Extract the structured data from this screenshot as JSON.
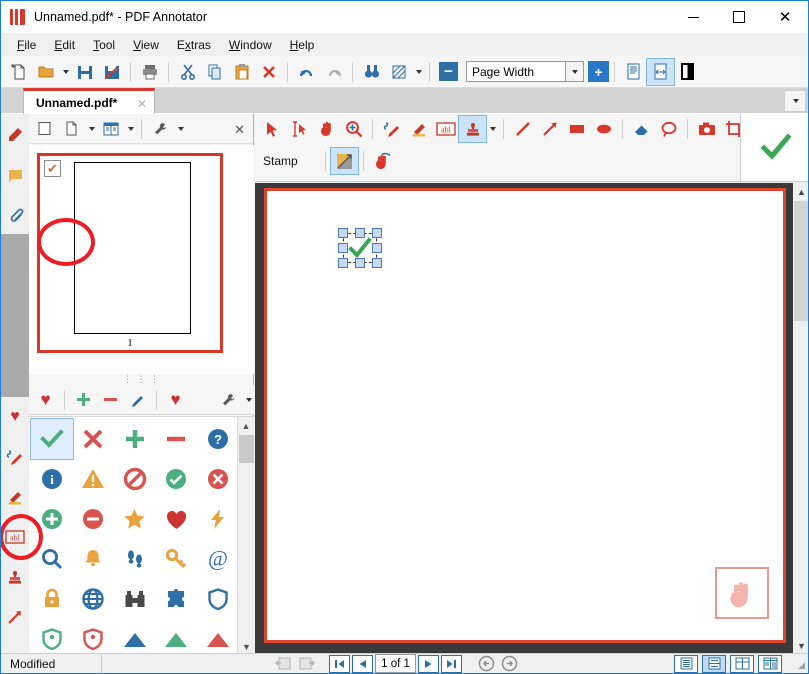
{
  "window": {
    "title": "Unnamed.pdf* - PDF Annotator",
    "app_icon": "pdf-annotator-logo-icon",
    "controls": {
      "minimize": "—",
      "maximize": "□",
      "close": "✕"
    }
  },
  "menu": {
    "items": [
      {
        "label": "File",
        "accel": "F"
      },
      {
        "label": "Edit",
        "accel": "E"
      },
      {
        "label": "Tool",
        "accel": "T"
      },
      {
        "label": "View",
        "accel": "V"
      },
      {
        "label": "Extras",
        "accel": "x"
      },
      {
        "label": "Window",
        "accel": "W"
      },
      {
        "label": "Help",
        "accel": "H"
      }
    ]
  },
  "main_toolbar": {
    "buttons": [
      {
        "name": "new-document-button",
        "tip": "New"
      },
      {
        "name": "open-document-button",
        "tip": "Open"
      },
      {
        "name": "save-button",
        "tip": "Save"
      },
      {
        "name": "save-as-button",
        "tip": "Save As"
      },
      {
        "name": "print-button",
        "tip": "Print"
      },
      {
        "name": "cut-button",
        "tip": "Cut"
      },
      {
        "name": "copy-button",
        "tip": "Copy"
      },
      {
        "name": "paste-button",
        "tip": "Paste"
      },
      {
        "name": "delete-button",
        "tip": "Delete"
      },
      {
        "name": "undo-button",
        "tip": "Undo"
      },
      {
        "name": "redo-button",
        "tip": "Redo"
      },
      {
        "name": "find-button",
        "tip": "Find"
      },
      {
        "name": "sharpen-button",
        "tip": "Enhance"
      }
    ],
    "zoom": {
      "out_label": "−",
      "value": "Page Width",
      "in_label": "+"
    },
    "page_modes": [
      {
        "name": "single-page-view-button"
      },
      {
        "name": "fit-width-view-button",
        "selected": true
      },
      {
        "name": "full-screen-view-button"
      }
    ]
  },
  "tabs": {
    "documents": [
      {
        "label": "Unnamed.pdf*",
        "close": "✕",
        "active": true
      }
    ],
    "overflow_icon": "chevron-down-icon"
  },
  "left_vertical_tabs": {
    "top_group": [
      {
        "name": "bookmarks-tab",
        "icon": "bookmark-icon",
        "color": "#c0392b"
      },
      {
        "name": "notes-tab",
        "icon": "note-icon",
        "color": "#e9b44c"
      },
      {
        "name": "attachments-tab",
        "icon": "paperclip-icon",
        "color": "#2e6fa8"
      }
    ],
    "bottom_group": [
      {
        "name": "favorites-tab",
        "icon": "heart-icon",
        "color": "#cc3333"
      },
      {
        "name": "pen-tab",
        "icon": "pen-icon",
        "color": "#2e6fa8"
      },
      {
        "name": "highlighter-tab",
        "icon": "highlighter-icon",
        "color": "#c0392b"
      },
      {
        "name": "text-tab",
        "icon": "abl-text-icon",
        "color": "#c0392b"
      },
      {
        "name": "stamps-tab",
        "icon": "stamp-icon",
        "color": "#c0392b",
        "selected": true
      },
      {
        "name": "arrow-tab",
        "icon": "arrow-icon",
        "color": "#d9372a"
      }
    ]
  },
  "left_panel": {
    "toolbar": [
      {
        "name": "thumbnail-toggle-button",
        "icon": "square-icon"
      },
      {
        "name": "page-layout-button",
        "icon": "page-icon"
      },
      {
        "name": "book-view-button",
        "icon": "book-icon"
      },
      {
        "name": "settings-button",
        "icon": "wrench-icon"
      }
    ],
    "close_label": "✕",
    "thumbnails": [
      {
        "page_number": "1",
        "checked": true,
        "selected": true
      }
    ]
  },
  "stamp_panel": {
    "toolbar": [
      {
        "name": "favorite-stamp-button",
        "icon": "heart-icon",
        "color": "#cc3333"
      },
      {
        "name": "add-stamp-button",
        "icon": "plus-icon",
        "color": "#4caf7d"
      },
      {
        "name": "remove-stamp-button",
        "icon": "minus-icon",
        "color": "#d9534f"
      },
      {
        "name": "edit-stamp-button",
        "icon": "pencil-icon",
        "color": "#2e6fa8"
      },
      {
        "name": "favorites-group-button",
        "icon": "heart-icon",
        "color": "#cc3333"
      },
      {
        "name": "stamp-settings-button",
        "icon": "wrench-icon",
        "color": "#555555"
      }
    ],
    "grid": [
      {
        "name": "stamp-check",
        "glyph": "✔",
        "color": "#4caf7d",
        "selected": true
      },
      {
        "name": "stamp-cross",
        "glyph": "✖",
        "color": "#d9534f"
      },
      {
        "name": "stamp-plus",
        "glyph": "✚",
        "color": "#4caf7d"
      },
      {
        "name": "stamp-minus",
        "glyph": "➖",
        "color": "#d9534f"
      },
      {
        "name": "stamp-question-circle",
        "glyph": "?",
        "color": "#2e6fa8"
      },
      {
        "name": "stamp-info-circle",
        "glyph": "i",
        "color": "#2e6fa8"
      },
      {
        "name": "stamp-warning-triangle",
        "glyph": "!",
        "color": "#e8a33d"
      },
      {
        "name": "stamp-no-entry",
        "glyph": "⃠",
        "color": "#d9534f"
      },
      {
        "name": "stamp-check-circle",
        "glyph": "✔",
        "color": "#4caf7d"
      },
      {
        "name": "stamp-cross-circle",
        "glyph": "✖",
        "color": "#d9534f"
      },
      {
        "name": "stamp-plus-circle",
        "glyph": "✚",
        "color": "#4caf7d"
      },
      {
        "name": "stamp-minus-circle",
        "glyph": "➖",
        "color": "#d9534f"
      },
      {
        "name": "stamp-star",
        "glyph": "★",
        "color": "#e8a33d"
      },
      {
        "name": "stamp-heart",
        "glyph": "♥",
        "color": "#cc3333"
      },
      {
        "name": "stamp-lightning",
        "glyph": "⚡",
        "color": "#e8a33d"
      },
      {
        "name": "stamp-magnifier",
        "glyph": "⚲",
        "color": "#2e6fa8"
      },
      {
        "name": "stamp-bell",
        "glyph": "ὑ4",
        "color": "#e8a33d"
      },
      {
        "name": "stamp-footprints",
        "glyph": "⁙",
        "color": "#2e6fa8"
      },
      {
        "name": "stamp-key",
        "glyph": "⚿",
        "color": "#e8a33d"
      },
      {
        "name": "stamp-at-sign",
        "glyph": "@",
        "color": "#2e6fa8"
      },
      {
        "name": "stamp-lock",
        "glyph": "ὑ2",
        "color": "#e8a33d"
      },
      {
        "name": "stamp-globe",
        "glyph": "ἱ0",
        "color": "#2e6fa8"
      },
      {
        "name": "stamp-binoculars",
        "glyph": "ὓD",
        "color": "#4a4a4a"
      },
      {
        "name": "stamp-puzzle",
        "glyph": "❖",
        "color": "#2e6fa8"
      },
      {
        "name": "stamp-shield",
        "glyph": "⛊",
        "color": "#2e6fa8"
      },
      {
        "name": "stamp-shield-green",
        "glyph": "⛊",
        "color": "#4caf7d"
      },
      {
        "name": "stamp-shield-red",
        "glyph": "⛊",
        "color": "#d9534f"
      },
      {
        "name": "stamp-flag-blue",
        "glyph": "◢",
        "color": "#2e6fa8"
      },
      {
        "name": "stamp-flag-green",
        "glyph": "◢",
        "color": "#4caf7d"
      },
      {
        "name": "stamp-flag-red",
        "glyph": "◢",
        "color": "#d9534f"
      }
    ]
  },
  "annotation_toolbar": {
    "row1": [
      {
        "name": "select-tool",
        "icon": "cursor-arrow-icon"
      },
      {
        "name": "text-select-tool",
        "icon": "text-cursor-icon"
      },
      {
        "name": "hand-tool",
        "icon": "hand-icon"
      },
      {
        "name": "zoom-tool",
        "icon": "magnifier-plus-icon"
      },
      {
        "name": "pen-tool",
        "icon": "pen-icon"
      },
      {
        "name": "highlighter-tool",
        "icon": "highlighter-icon"
      },
      {
        "name": "text-box-tool",
        "icon": "abl-text-icon"
      },
      {
        "name": "stamp-tool",
        "icon": "stamp-icon",
        "selected": true
      },
      {
        "name": "line-tool",
        "icon": "line-icon"
      },
      {
        "name": "arrow-tool",
        "icon": "arrow-icon"
      },
      {
        "name": "rectangle-tool",
        "icon": "rectangle-icon"
      },
      {
        "name": "ellipse-tool",
        "icon": "ellipse-icon"
      },
      {
        "name": "eraser-tool",
        "icon": "eraser-icon"
      },
      {
        "name": "lasso-tool",
        "icon": "lasso-icon"
      },
      {
        "name": "snapshot-tool",
        "icon": "camera-icon"
      },
      {
        "name": "crop-tool",
        "icon": "crop-icon"
      },
      {
        "name": "insert-image-tool",
        "icon": "image-add-icon"
      },
      {
        "name": "favorites-tool",
        "icon": "heart-icon"
      }
    ],
    "row2": {
      "label": "Stamp",
      "buttons": [
        {
          "name": "resize-stamp-button",
          "icon": "resize-diagonal-icon",
          "selected": true
        },
        {
          "name": "hand-stamp-button",
          "icon": "hand-stamp-icon"
        }
      ]
    },
    "preview": {
      "name": "stamp-preview",
      "icon": "green-check-icon",
      "color": "#3aa657"
    }
  },
  "document": {
    "placed_annotation": {
      "name": "placed-check-stamp",
      "glyph": "✔",
      "color": "#3aa657",
      "selected": true
    },
    "cursor_preview": {
      "name": "hand-stamp-cursor",
      "icon": "hand-icon",
      "color": "#f0a8a0"
    }
  },
  "status_bar": {
    "status": "Modified",
    "nav": {
      "rotate_left": {
        "name": "rotate-left-button",
        "icon": "rotate-left-icon"
      },
      "rotate_right": {
        "name": "rotate-right-button",
        "icon": "rotate-right-icon"
      },
      "first": "⏮",
      "prev": "◀",
      "page_value": "1 of 1",
      "next": "▶",
      "last": "⏭",
      "back": "←",
      "forward": "→"
    },
    "view_modes": [
      {
        "name": "view-mode-single",
        "selected": false
      },
      {
        "name": "view-mode-continuous",
        "selected": true
      },
      {
        "name": "view-mode-facing",
        "selected": false
      },
      {
        "name": "view-mode-book",
        "selected": false
      }
    ]
  }
}
